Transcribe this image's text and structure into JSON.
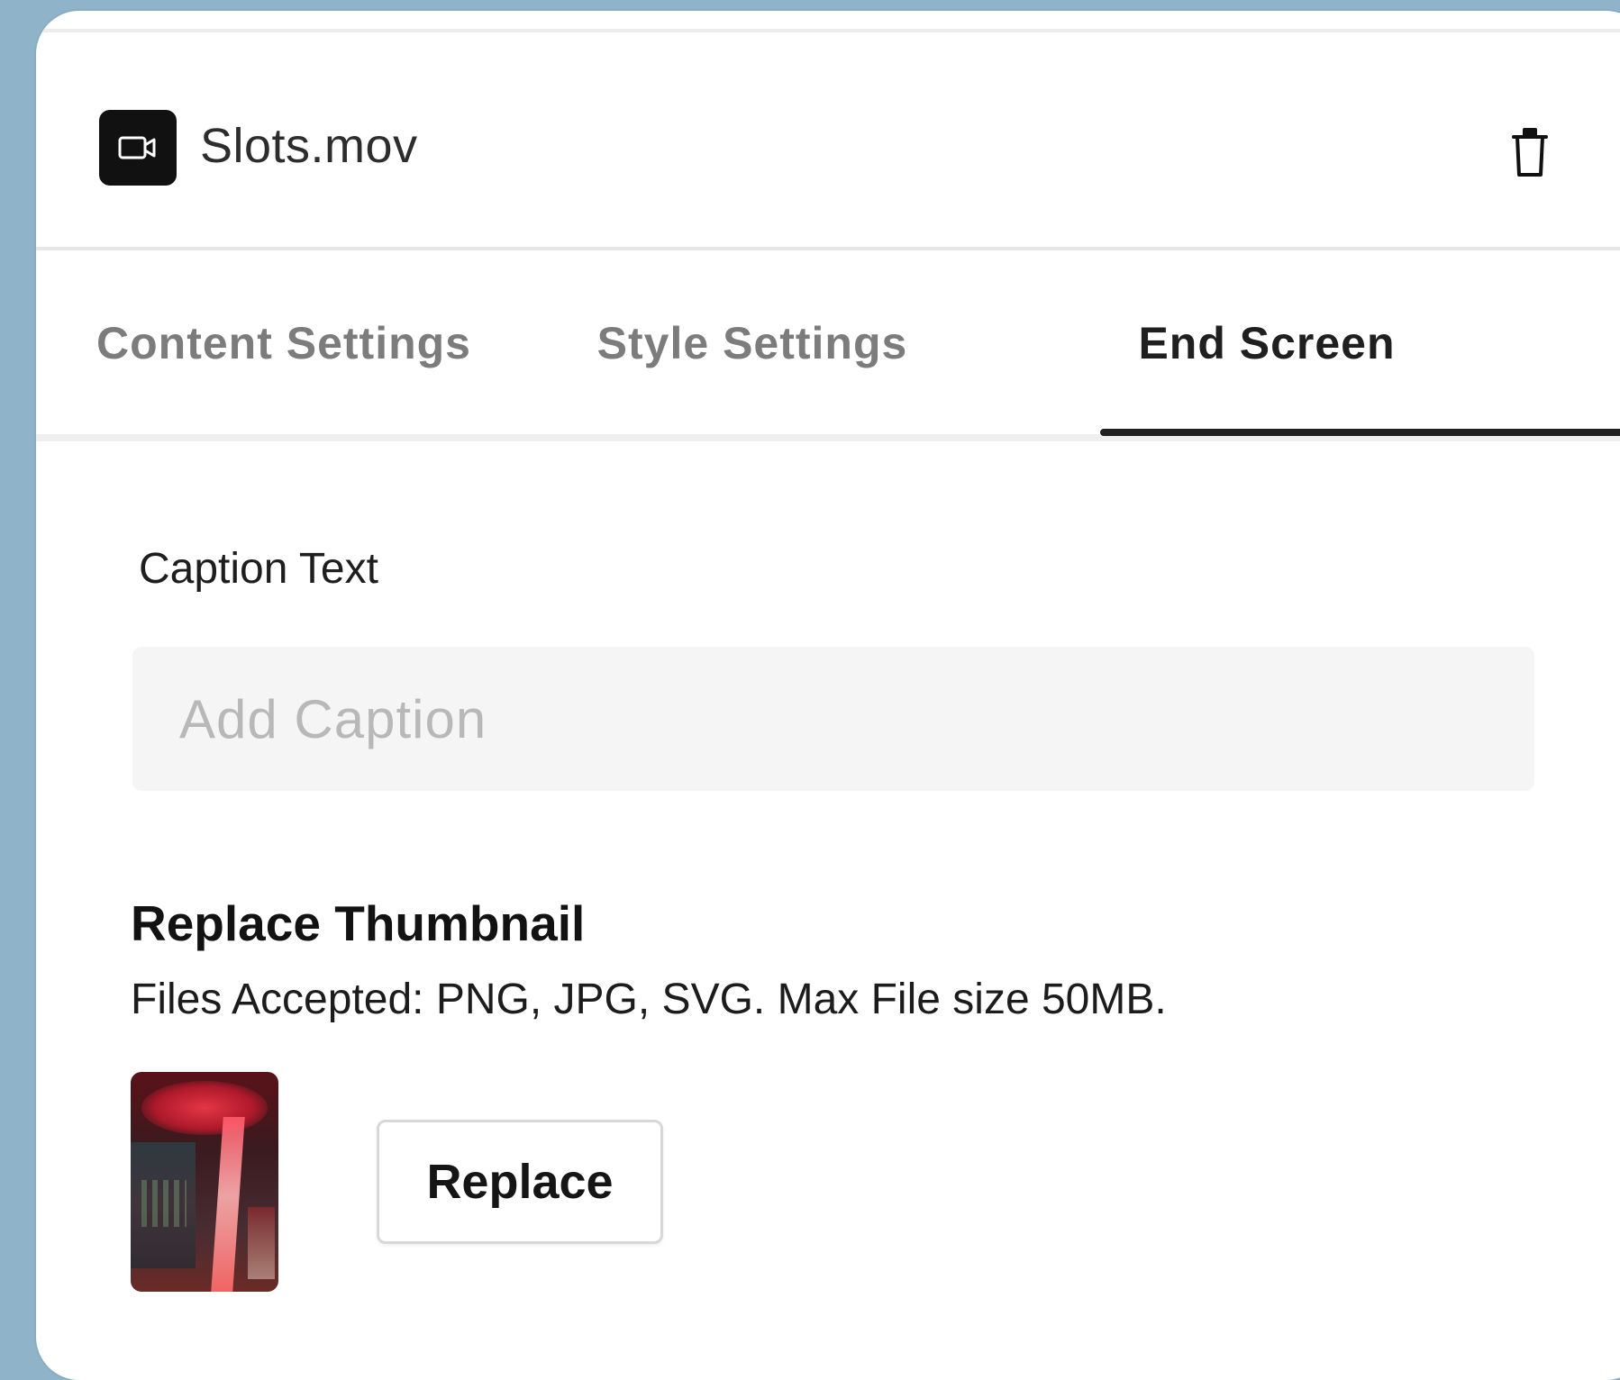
{
  "header": {
    "file_name": "Slots.mov",
    "file_icon": "video-camera-icon",
    "delete_icon": "trash-icon"
  },
  "tabs": [
    {
      "label": "Content Settings",
      "active": false
    },
    {
      "label": "Style Settings",
      "active": false
    },
    {
      "label": "End Screen",
      "active": true
    }
  ],
  "caption": {
    "label": "Caption Text",
    "value": "",
    "placeholder": "Add Caption"
  },
  "thumbnail": {
    "heading": "Replace Thumbnail",
    "note": "Files Accepted: PNG, JPG, SVG. Max File size 50MB.",
    "replace_label": "Replace"
  },
  "colors": {
    "background": "#8fb3c8",
    "panel": "#ffffff",
    "active_tab": "#1f1f1f",
    "inactive_tab": "#7c7c7c"
  }
}
